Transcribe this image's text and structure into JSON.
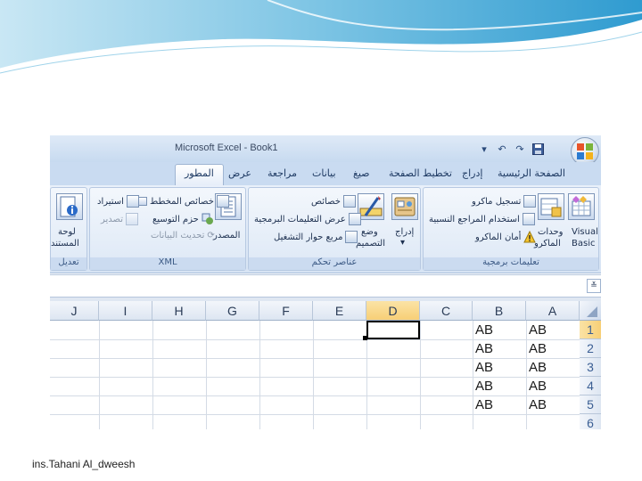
{
  "window": {
    "title": "Microsoft Excel - Book1"
  },
  "ribbon": {
    "tabs": [
      {
        "label": "الصفحة الرئيسية",
        "active": false
      },
      {
        "label": "إدراج",
        "active": false
      },
      {
        "label": "تخطيط الصفحة",
        "active": false
      },
      {
        "label": "صيغ",
        "active": false
      },
      {
        "label": "بيانات",
        "active": false
      },
      {
        "label": "مراجعة",
        "active": false
      },
      {
        "label": "عرض",
        "active": false
      },
      {
        "label": "المطور",
        "active": true
      }
    ],
    "groups": {
      "code": {
        "label": "تعليمات برمجية",
        "visual_basic_line1": "Visual",
        "visual_basic_line2": "Basic",
        "macros_line1": "وحدات",
        "macros_line2": "الماكرو",
        "record_macro": "تسجيل ماكرو",
        "relative_refs": "استخدام المراجع النسبية",
        "macro_security": "أمان الماكرو"
      },
      "controls": {
        "label": "عناصر تحكم",
        "insert": "إدراج",
        "design_mode_line1": "وضع",
        "design_mode_line2": "التصميم",
        "properties": "خصائص",
        "view_code": "عرض التعليمات البرمجية",
        "run_dialog": "مربع حوار التشغيل"
      },
      "xml": {
        "label": "XML",
        "source": "المصدر",
        "map_properties": "خصائص المخطط",
        "expansion_packs": "حزم التوسيع",
        "refresh_data": "تحديث البيانات",
        "import": "استيراد",
        "export": "تصدير"
      },
      "modify": {
        "label": "تعديل",
        "doc_panel_line1": "لوحة",
        "doc_panel_line2": "المستند"
      }
    }
  },
  "sheet": {
    "columns": [
      "A",
      "B",
      "C",
      "D",
      "E",
      "F",
      "G",
      "H",
      "I",
      "J"
    ],
    "selected_column": "D",
    "rows": [
      "1",
      "2",
      "3",
      "4",
      "5",
      "6"
    ],
    "selected_row": "1",
    "cells": {
      "A": [
        "AB",
        "AB",
        "AB",
        "AB",
        "AB"
      ],
      "B": [
        "AB",
        "AB",
        "AB",
        "AB",
        "AB"
      ]
    }
  },
  "footer": {
    "credit": "ins.Tahani Al_dweesh"
  },
  "colors": {
    "accent": "#4aa8d8",
    "selected_header": "#f7cf76"
  }
}
